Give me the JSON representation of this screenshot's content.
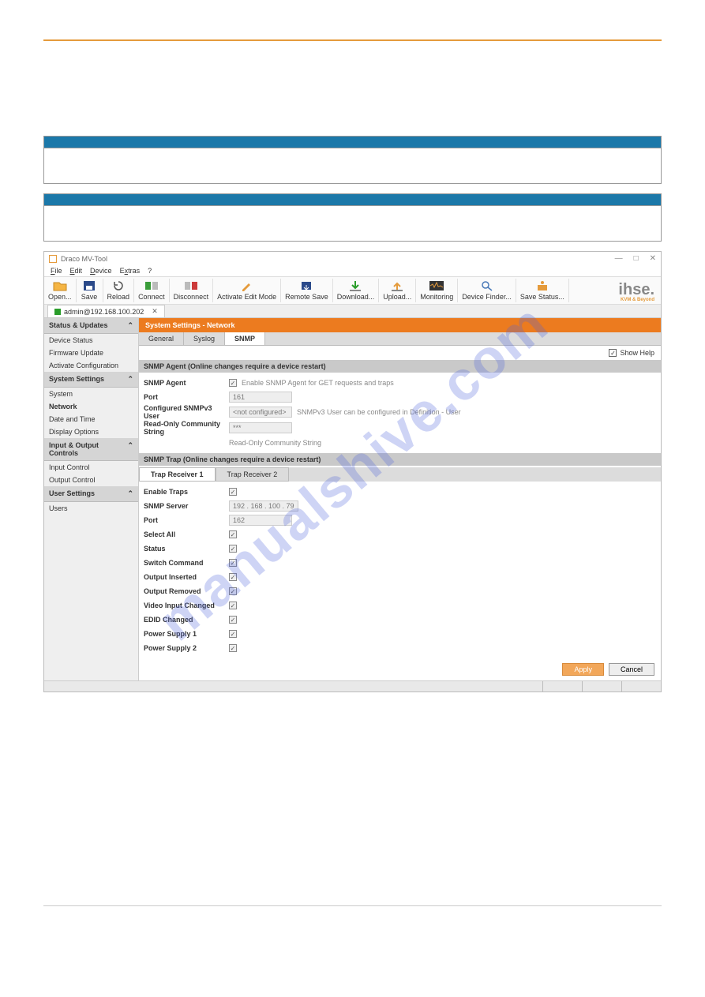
{
  "tables": {
    "t1": {
      "header": "",
      "rows": [
        {
          "k": "",
          "v": ""
        }
      ]
    },
    "t2": {
      "header": "",
      "rows": [
        {
          "k": "",
          "v": ""
        }
      ]
    }
  },
  "app": {
    "title": "Draco MV-Tool",
    "menu": {
      "file": "File",
      "edit": "Edit",
      "device": "Device",
      "extras": "Extras",
      "help": "?"
    },
    "toolbar": {
      "open": "Open...",
      "save": "Save",
      "reload": "Reload",
      "connect": "Connect",
      "disconnect": "Disconnect",
      "activate": "Activate Edit Mode",
      "remote": "Remote Save",
      "download": "Download...",
      "upload": "Upload...",
      "monitoring": "Monitoring",
      "devicefinder": "Device Finder...",
      "savestatus": "Save Status..."
    },
    "logo": "ihse.",
    "logo_sub": "KVM & Beyond",
    "conn_tab": "admin@192.168.100.202"
  },
  "sidebar": {
    "g1": "Status & Updates",
    "i11": "Device Status",
    "i12": "Firmware Update",
    "i13": "Activate Configuration",
    "g2": "System Settings",
    "i21": "System",
    "i22": "Network",
    "i23": "Date and Time",
    "i24": "Display Options",
    "g3": "Input & Output Controls",
    "i31": "Input Control",
    "i32": "Output Control",
    "g4": "User Settings",
    "i41": "Users"
  },
  "panel": {
    "title": "System Settings - Network",
    "tabs": {
      "general": "General",
      "syslog": "Syslog",
      "snmp": "SNMP"
    },
    "showhelp": "Show Help",
    "sec_agent": "SNMP Agent (Online changes require a device restart)",
    "agent": {
      "lbl": "SNMP Agent",
      "hint": "Enable SNMP Agent for GET requests and traps"
    },
    "port": {
      "lbl": "Port",
      "val": "161"
    },
    "v3user": {
      "lbl": "Configured SNMPv3 User",
      "val": "<not configured>",
      "hint": "SNMPv3 User can be configured in Definition - User"
    },
    "community": {
      "lbl": "Read-Only Community String",
      "val": "***",
      "hint": "Read-Only Community String"
    },
    "sec_trap": "SNMP Trap (Online changes require a device restart)",
    "trap_tabs": {
      "r1": "Trap Receiver 1",
      "r2": "Trap Receiver 2"
    },
    "enable": {
      "lbl": "Enable Traps"
    },
    "server": {
      "lbl": "SNMP Server",
      "val": "192 . 168 . 100 .  79"
    },
    "tport": {
      "lbl": "Port",
      "val": "162"
    },
    "selall": "Select All",
    "status": "Status",
    "switchcmd": "Switch Command",
    "outins": "Output Inserted",
    "outrem": "Output Removed",
    "vidchg": "Video Input Changed",
    "edid": "EDID Changed",
    "ps1": "Power Supply 1",
    "ps2": "Power Supply 2",
    "apply": "Apply",
    "cancel": "Cancel"
  },
  "watermark": "manualshive.com",
  "caption": ""
}
